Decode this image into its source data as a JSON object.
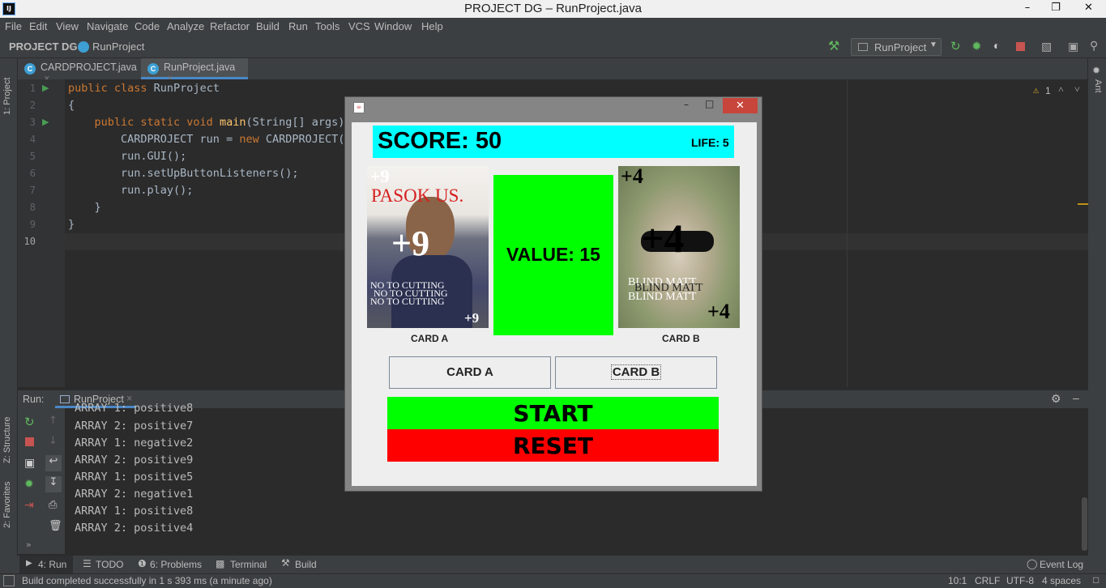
{
  "window": {
    "title": "PROJECT DG – RunProject.java",
    "app_icon": "IJ"
  },
  "menu": [
    "File",
    "Edit",
    "View",
    "Navigate",
    "Code",
    "Analyze",
    "Refactor",
    "Build",
    "Run",
    "Tools",
    "VCS",
    "Window",
    "Help"
  ],
  "breadcrumb": {
    "project": "PROJECT DG",
    "file": "RunProject"
  },
  "run_config": "RunProject",
  "tabs": [
    {
      "label": "CARDPROJECT.java"
    },
    {
      "label": "RunProject.java"
    }
  ],
  "editor": {
    "lines": [
      {
        "num": "1",
        "kw": "public class ",
        "rest": "RunProject"
      },
      {
        "num": "2",
        "kw": "",
        "rest": "{"
      },
      {
        "num": "3",
        "kw": "    public static void ",
        "fn": "main",
        "rest": "(String[] args) {"
      },
      {
        "num": "4",
        "kw": "",
        "rest": "        CARDPROJECT run = ",
        "kw2": "new ",
        "rest2": "CARDPROJECT("
      },
      {
        "num": "5",
        "kw": "",
        "rest": "        run.GUI();"
      },
      {
        "num": "6",
        "kw": "",
        "rest": "        run.setUpButtonListeners();"
      },
      {
        "num": "7",
        "kw": "",
        "rest": "        run.play();"
      },
      {
        "num": "8",
        "kw": "",
        "rest": "    }"
      },
      {
        "num": "9",
        "kw": "",
        "rest": "}"
      },
      {
        "num": "10",
        "kw": "",
        "rest": ""
      }
    ],
    "warnings": "1"
  },
  "run_panel": {
    "label": "Run:",
    "tab": "RunProject",
    "output": [
      "ARRAY 1: positive8",
      "ARRAY 2: positive7",
      "ARRAY 1: negative2",
      "ARRAY 2: positive9",
      "ARRAY 1: positive5",
      "ARRAY 2: negative1",
      "ARRAY 1: positive8",
      "ARRAY 2: positive4"
    ]
  },
  "side_tabs": {
    "project": "1: Project",
    "structure": "Z: Structure",
    "favorites": "2: Favorites",
    "ant": "Ant"
  },
  "bottom_tabs": {
    "run": "4: Run",
    "todo": "TODO",
    "problems": "6: Problems",
    "terminal": "Terminal",
    "build": "Build",
    "event_log": "Event Log"
  },
  "status": {
    "message": "Build completed successfully in 1 s 393 ms (a minute ago)",
    "position": "10:1",
    "line_sep": "CRLF",
    "encoding": "UTF-8",
    "indent": "4 spaces"
  },
  "game": {
    "score_label": "SCORE: 50",
    "life_label": "LIFE: 5",
    "value_label": "VALUE: 15",
    "card_a": {
      "caption": "CARD A",
      "corner": "+9",
      "center": "+9",
      "top_text": "PASOK US.",
      "bottom_text": "NO TO CUTTING"
    },
    "card_b": {
      "caption": "CARD B",
      "corner": "+4",
      "center": "+4",
      "bottom_text": "BLIND MATT"
    },
    "btn_card_a": "CARD A",
    "btn_card_b": "CARD B",
    "btn_start": "START",
    "btn_reset": "RESET",
    "colors": {
      "score_bg": "#00ffff",
      "value_bg": "#00ff00",
      "start_bg": "#00ff00",
      "reset_bg": "#ff0000"
    }
  }
}
